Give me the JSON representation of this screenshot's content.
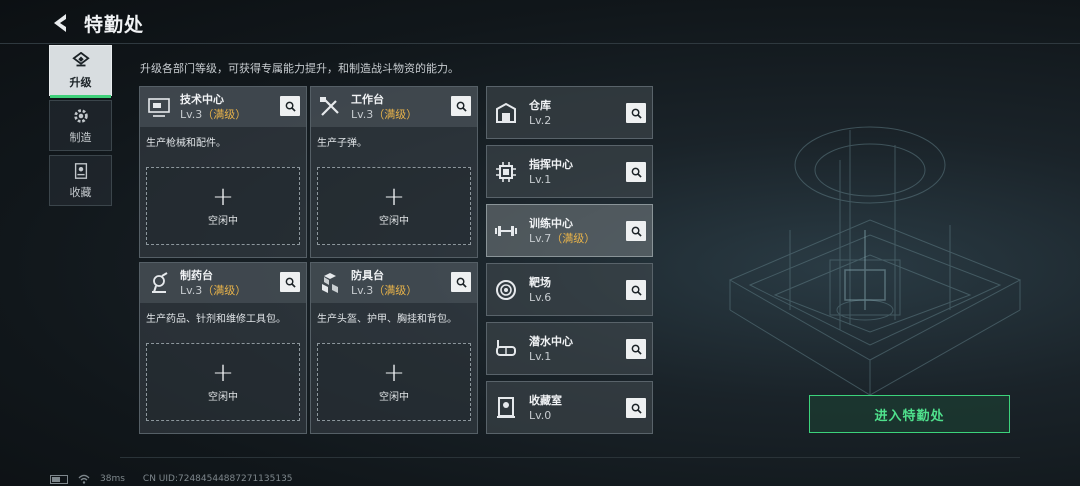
{
  "header": {
    "title": "特勤处"
  },
  "subtitle": "升级各部门等级，可获得专属能力提升，和制造战斗物资的能力。",
  "nav": [
    {
      "label": "升级",
      "icon": "upgrade-icon",
      "active": true
    },
    {
      "label": "制造",
      "icon": "gear-icon",
      "active": false
    },
    {
      "label": "收藏",
      "icon": "collection-icon",
      "active": false
    }
  ],
  "cards": [
    {
      "name": "技术中心",
      "level": "Lv.3",
      "max": "（满级）",
      "desc": "生产枪械和配件。",
      "slot_plus": "+",
      "slot_label": "空闲中",
      "icon": "tech-center-icon"
    },
    {
      "name": "工作台",
      "level": "Lv.3",
      "max": "（满级）",
      "desc": "生产子弹。",
      "slot_plus": "+",
      "slot_label": "空闲中",
      "icon": "workbench-tools-icon"
    },
    {
      "name": "制药台",
      "level": "Lv.3",
      "max": "（满级）",
      "desc": "生产药品、针剂和维修工具包。",
      "slot_plus": "+",
      "slot_label": "空闲中",
      "icon": "microscope-icon"
    },
    {
      "name": "防具台",
      "level": "Lv.3",
      "max": "（满级）",
      "desc": "生产头盔、护甲、胸挂和背包。",
      "slot_plus": "+",
      "slot_label": "空闲中",
      "icon": "armor-boxes-icon"
    }
  ],
  "facilities": [
    {
      "name": "仓库",
      "level": "Lv.2",
      "max": "",
      "icon": "warehouse-icon"
    },
    {
      "name": "指挥中心",
      "level": "Lv.1",
      "max": "",
      "icon": "command-chip-icon"
    },
    {
      "name": "训练中心",
      "level": "Lv.7",
      "max": "（满级）",
      "icon": "dumbbell-icon",
      "selected": true
    },
    {
      "name": "靶场",
      "level": "Lv.6",
      "max": "",
      "icon": "target-icon"
    },
    {
      "name": "潜水中心",
      "level": "Lv.1",
      "max": "",
      "icon": "diving-mask-icon"
    },
    {
      "name": "收藏室",
      "level": "Lv.0",
      "max": "",
      "icon": "display-case-icon"
    }
  ],
  "enter_button": "进入特勤处",
  "footer": {
    "ping": "38ms",
    "uid": "CN UID:7248454488727113513​5"
  },
  "colors": {
    "accent": "#3cd37b",
    "max_level": "#e8b34a"
  }
}
